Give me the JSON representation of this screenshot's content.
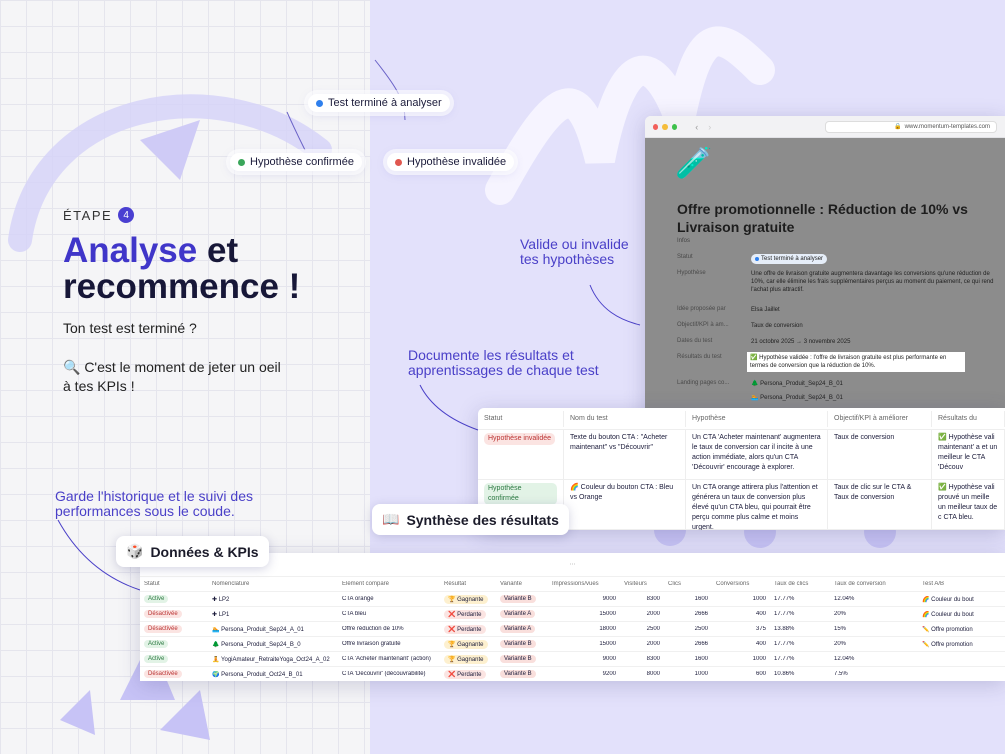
{
  "pills": {
    "tested": "Test terminé à analyser",
    "confirmed": "Hypothèse confirmée",
    "invalid": "Hypothèse invalidée"
  },
  "hero": {
    "stage_label": "ÉTAPE",
    "stage_num": "4",
    "accent": "Analyse",
    "rest1": " et",
    "line2": "recommence !",
    "p1": "Ton test est terminé ?",
    "p2": "🔍 C'est le moment de jeter un oeil à tes KPIs !"
  },
  "annotations": {
    "valid": "Valide ou invalide\ntes hypothèses",
    "doc": "Documente les résultats et\napprentissages de chaque test",
    "hist": "Garde l'historique et le suivi des\nperformances sous le coude."
  },
  "tags": {
    "synthese": "Synthèse des résultats",
    "donnees": "Données & KPIs"
  },
  "browser": {
    "url": "www.momentum-templates.com",
    "title": "Offre promotionnelle : Réduction de 10% vs Livraison gratuite",
    "infos": "Infos",
    "props": [
      {
        "k": "Statut",
        "v": "Test terminé à analyser"
      },
      {
        "k": "Hypothèse",
        "v": "Une offre de livraison gratuite augmentera davantage les conversions qu'une réduction de 10%, car elle élimine les frais supplémentaires perçus au moment du paiement, ce qui rend l'achat plus attractif."
      },
      {
        "k": "Idée proposée par",
        "v": "Elsa Jaillet"
      },
      {
        "k": "Objectif/KPI à am...",
        "v": "Taux de conversion"
      },
      {
        "k": "Dates du test",
        "v": "21 octobre 2025 → 3 novembre 2025"
      },
      {
        "k": "Résultats du test",
        "v": "✅ Hypothèse validée : l'offre de livraison gratuite est plus performante en termes de conversion que la réduction de 10%."
      },
      {
        "k": "Landing pages co...",
        "v": "🌲 Persona_Produit_Sep24_B_01"
      },
      {
        "k": "",
        "v": "🏊 Persona_Produit_Sep24_B_01"
      }
    ]
  },
  "table1": {
    "headers": [
      "Statut",
      "Nom du test",
      "Hypothèse",
      "Objectif/KPI à améliorer",
      "Résultats du"
    ],
    "rows": [
      [
        "Hypothèse invalidée",
        "Texte du bouton CTA : \"Acheter maintenant\" vs \"Découvrir\"",
        "Un CTA 'Acheter maintenant' augmentera le taux de conversion car il incite à une action immédiate, alors qu'un CTA 'Découvrir' encourage à explorer.",
        "Taux de conversion",
        "✅ Hypothèse vali maintenant' a et un meilleur le CTA 'Découv"
      ],
      [
        "Hypothèse confirmée",
        "🌈 Couleur du bouton CTA : Bleu vs Orange",
        "Un CTA orange attirera plus l'attention et générera un taux de conversion plus élevé qu'un CTA bleu, qui pourrait être perçu comme plus calme et moins urgent.",
        "Taux de clic sur le CTA & Taux de conversion",
        "✅ Hypothèse vali prouvé un meille un meilleur taux de c CTA bleu."
      ]
    ]
  },
  "table2": {
    "headers": [
      "Statut",
      "Nomenclature",
      "Élément comparé",
      "Résultat",
      "Variante",
      "Impressions/vues",
      "Visiteurs",
      "Clics",
      "Conversions",
      "Taux de clics",
      "Taux de conversion",
      "Test A/B"
    ],
    "rows": [
      [
        "Active",
        "✚ LP2",
        "CTA orange",
        "🏆 Gagnante",
        "Variante B",
        "9000",
        "8300",
        "1600",
        "1000",
        "17.77%",
        "12.04%",
        "🌈 Couleur du bout"
      ],
      [
        "Désactivée",
        "✚ LP1",
        "CTA bleu",
        "❌ Perdante",
        "Variante A",
        "15000",
        "2000",
        "2666",
        "400",
        "17.77%",
        "20%",
        "🌈 Couleur du bout"
      ],
      [
        "Désactivée",
        "🏊 Persona_Produit_Sep24_A_01",
        "Offre réduction de 10%",
        "❌ Perdante",
        "Variante A",
        "18000",
        "2500",
        "2500",
        "375",
        "13.88%",
        "15%",
        "✏️ Offre promotion"
      ],
      [
        "Active",
        "🌲 Persona_Produit_Sep24_B_0",
        "Offre livraison gratuite",
        "🏆 Gagnante",
        "Variante B",
        "15000",
        "2000",
        "2666",
        "400",
        "17.77%",
        "20%",
        "✏️ Offre promotion"
      ],
      [
        "Active",
        "🧘 YogiAmateur_RetraiteYoga_Oct24_A_02",
        "CTA 'Acheter maintenant' (action)",
        "🏆 Gagnante",
        "Variante B",
        "9000",
        "8300",
        "1600",
        "1000",
        "17.77%",
        "12.04%",
        ""
      ],
      [
        "Désactivée",
        "🌍 Persona_Produit_Oct24_B_01",
        "CTA 'Découvrir' (découvrabilité)",
        "❌ Perdante",
        "Variante B",
        "9200",
        "8000",
        "1000",
        "600",
        "10.86%",
        "7.5%",
        ""
      ]
    ]
  },
  "colors": {
    "accent": "#4036c9",
    "blue": "#2f80ed",
    "green": "#3aa65a",
    "red": "#e0574f"
  }
}
